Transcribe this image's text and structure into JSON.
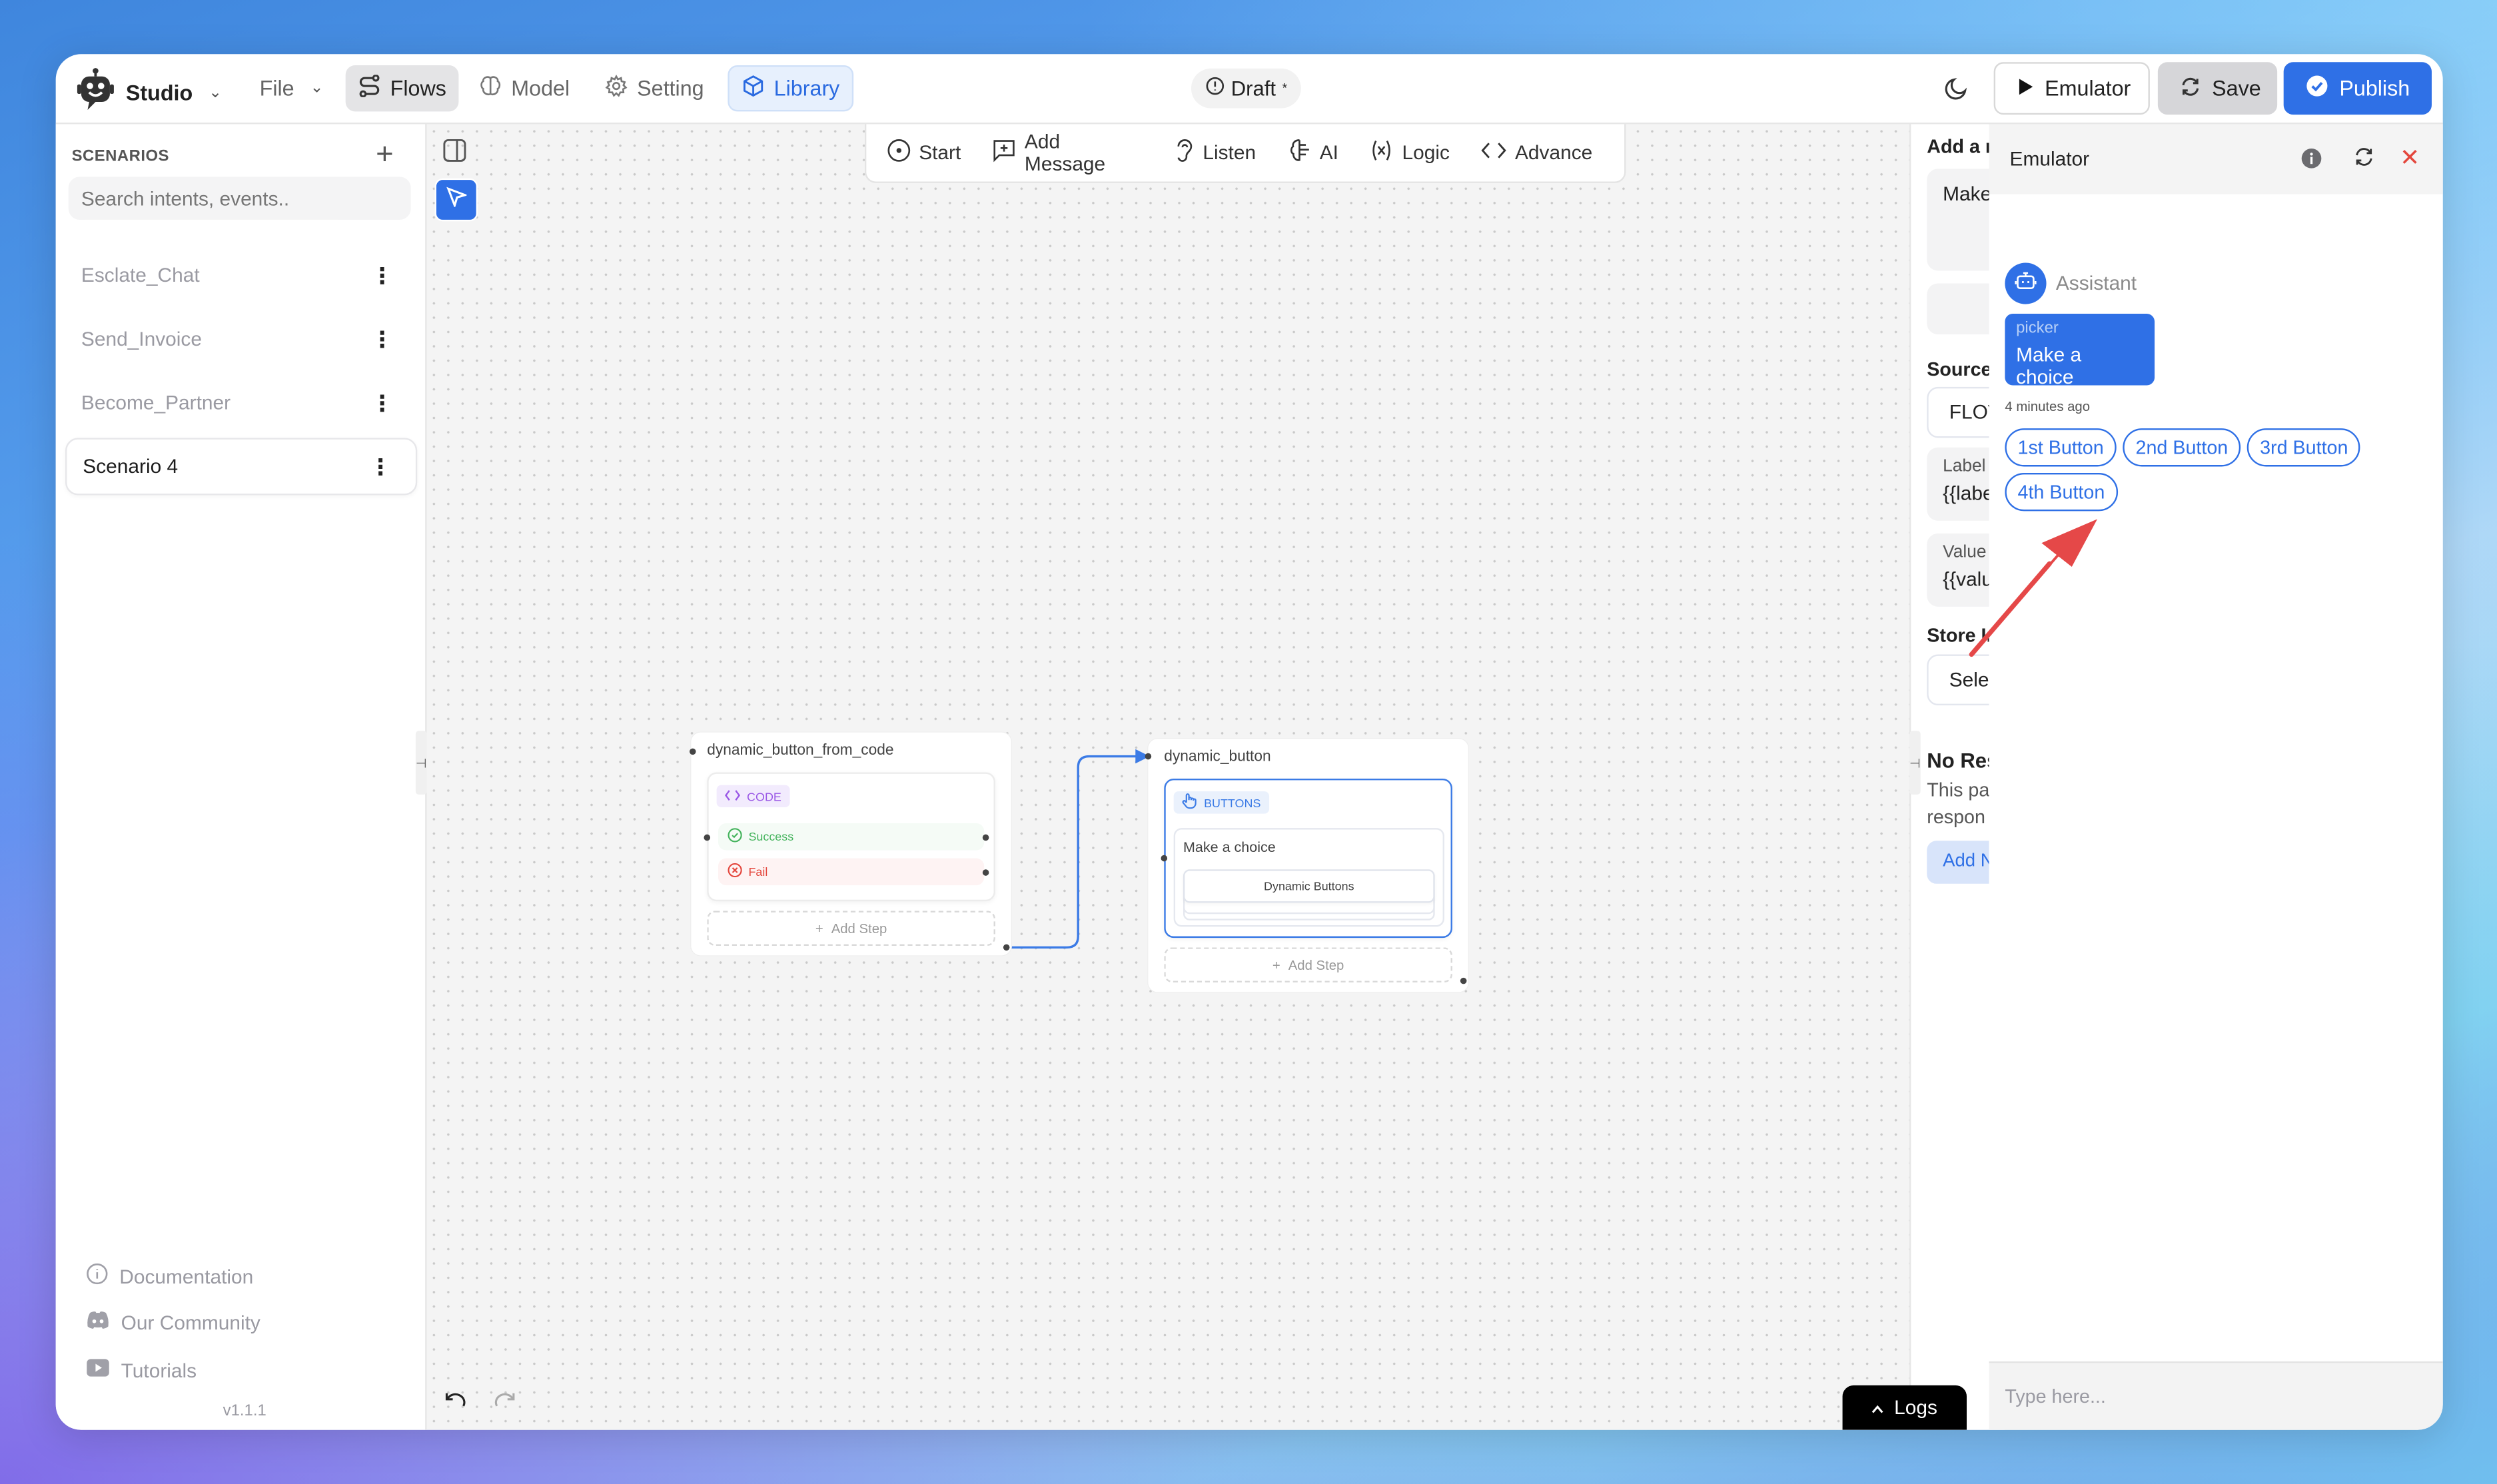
{
  "app": {
    "name": "Studio",
    "nav": {
      "file": "File",
      "flows": "Flows",
      "model": "Model",
      "setting": "Setting",
      "library": "Library"
    },
    "status": {
      "label": "Draft",
      "marker": "*"
    },
    "actions": {
      "emulator": "Emulator",
      "save": "Save",
      "publish": "Publish"
    },
    "colors": {
      "accent": "#2f70e6",
      "danger": "#e4473d",
      "success": "#44b35c",
      "code": "#9b59e6"
    }
  },
  "sidebar": {
    "title": "SCENARIOS",
    "search_placeholder": "Search intents, events..",
    "scenarios": [
      {
        "label": "Esclate_Chat",
        "active": false
      },
      {
        "label": "Send_Invoice",
        "active": false
      },
      {
        "label": "Become_Partner",
        "active": false
      },
      {
        "label": "Scenario 4",
        "active": true
      }
    ],
    "links": [
      {
        "label": "Documentation",
        "icon": "info-icon"
      },
      {
        "label": "Our Community",
        "icon": "discord-icon"
      },
      {
        "label": "Tutorials",
        "icon": "youtube-icon"
      }
    ],
    "version": "v1.1.1"
  },
  "toolbox": {
    "items": [
      {
        "label": "Start",
        "icon": "start-icon"
      },
      {
        "label": "Add Message",
        "icon": "message-plus-icon"
      },
      {
        "label": "Listen",
        "icon": "ear-icon"
      },
      {
        "label": "AI",
        "icon": "ai-icon"
      },
      {
        "label": "Logic",
        "icon": "variable-icon"
      },
      {
        "label": "Advance",
        "icon": "code-icon"
      }
    ]
  },
  "canvas": {
    "nodes": [
      {
        "title": "dynamic_button_from_code",
        "step_type": "CODE",
        "paths": {
          "success": "Success",
          "fail": "Fail"
        },
        "add_step": "Add Step"
      },
      {
        "title": "dynamic_button",
        "step_type": "BUTTONS",
        "message": "Make a choice",
        "buttons_label": "Dynamic Buttons",
        "add_step": "Add Step"
      }
    ],
    "logs_label": "Logs"
  },
  "properties": {
    "heading": "Add a r",
    "message_preview": "Make",
    "source_label": "Source",
    "source_value": "FLOV",
    "label_field": {
      "label": "Label",
      "value": "{{labe"
    },
    "value_field": {
      "label": "Value",
      "value": "{{valu"
    },
    "store_label": "Store Ir",
    "store_value": "Selec",
    "no_response_title": "No Res",
    "no_response_desc_1": "This pa",
    "no_response_desc_2": "respon",
    "add_button": "Add N"
  },
  "emulator": {
    "title": "Emulator",
    "sender": "Assistant",
    "message": {
      "type": "picker",
      "text": "Make a choice",
      "time": "4 minutes ago"
    },
    "choices": [
      "1st Button",
      "2nd Button",
      "3rd Button",
      "4th Button"
    ],
    "input_placeholder": "Type here..."
  }
}
